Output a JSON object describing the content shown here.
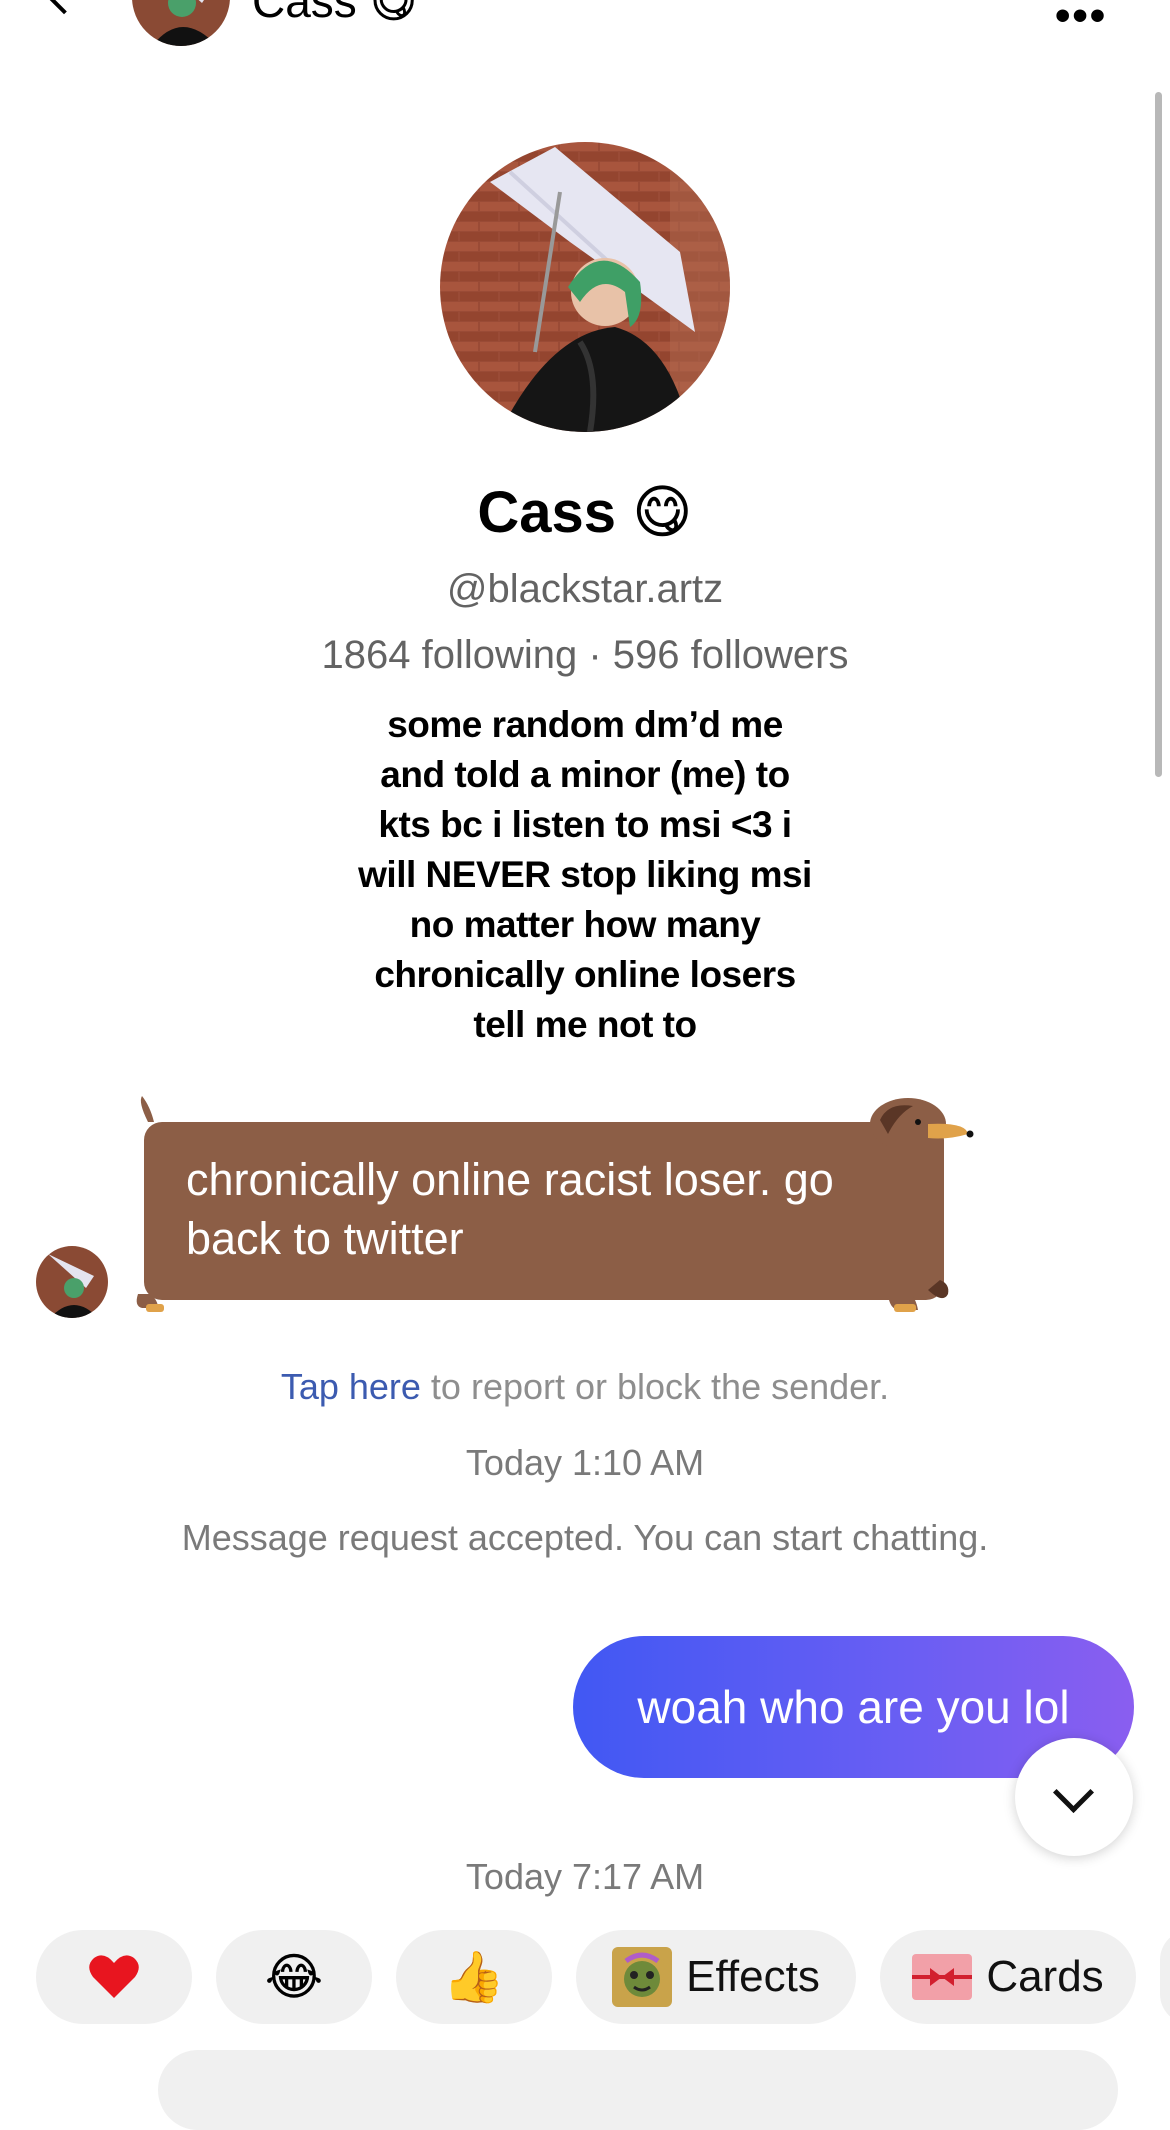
{
  "header": {
    "name": "Cass 😋"
  },
  "profile": {
    "name": "Cass 😋",
    "handle": "@blackstar.artz",
    "stats": "1864 following · 596 followers",
    "bio_lines": [
      "some random dm’d me",
      "and told a minor (me) to",
      "kts bc i listen to msi <3 i",
      "will NEVER stop liking msi",
      "no matter how many",
      "chronically online losers",
      "tell me not to"
    ]
  },
  "messages": {
    "received_text": "chronically online racist loser. go back to twitter",
    "report_link": "Tap here",
    "report_rest": " to report or block the sender.",
    "timestamp_1": "Today 1:10 AM",
    "accepted_notice": "Message request accepted. You can start chatting.",
    "sent_text": "woah who are you lol",
    "timestamp_2": "Today 7:17 AM"
  },
  "quick_replies": {
    "laugh_emoji": "😂",
    "thumbs_emoji": "👍",
    "effects_label": "Effects",
    "cards_label": "Cards"
  },
  "colors": {
    "sent_bubble_start": "#4158f3",
    "sent_bubble_end": "#8a5ef0",
    "received_bubble": "#8c5e46",
    "link": "#3c5bb0"
  }
}
